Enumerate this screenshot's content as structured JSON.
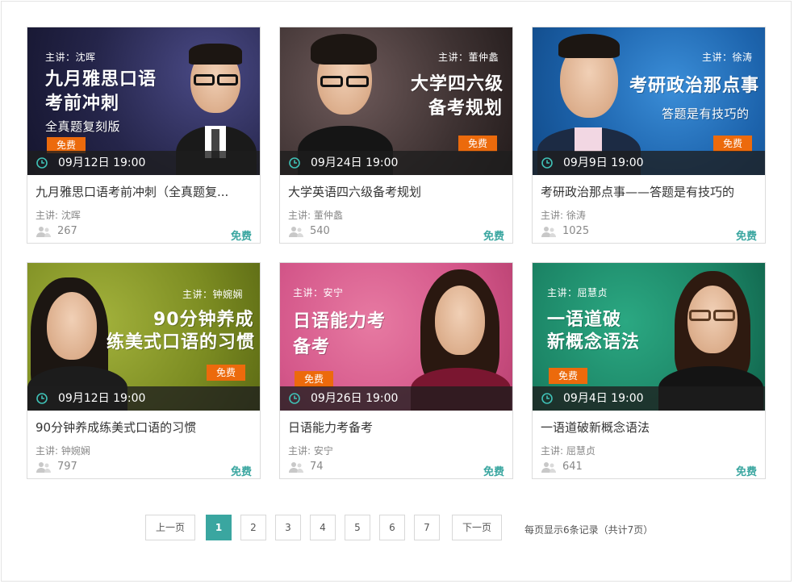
{
  "courses": [
    {
      "banner_teacher": "主讲：沈晖",
      "banner_lines": [
        "九月雅思口语",
        "考前冲刺"
      ],
      "banner_sub": "全真题复刻版",
      "free_badge": "免费",
      "datetime": "09月12日 19:00",
      "title": "九月雅思口语考前冲刺（全真题复...",
      "teacher": "主讲: 沈晖",
      "views": "267",
      "price": "免费",
      "bg_color": "#2a2a52"
    },
    {
      "banner_teacher": "主讲：董仲蠡",
      "banner_lines": [
        "大学四六级",
        "备考规划"
      ],
      "banner_sub": "",
      "free_badge": "免费",
      "datetime": "09月24日 19:00",
      "title": "大学英语四六级备考规划",
      "teacher": "主讲: 董仲蠡",
      "views": "540",
      "price": "免费",
      "bg_color": "#5a4a4a"
    },
    {
      "banner_teacher": "主讲：徐涛",
      "banner_lines": [
        "考研政治那点事"
      ],
      "banner_sub": "答题是有技巧的",
      "free_badge": "免费",
      "datetime": "09月9日 19:00",
      "title": "考研政治那点事——答题是有技巧的",
      "teacher": "主讲: 徐涛",
      "views": "1025",
      "price": "免费",
      "bg_color": "#1f6fb8"
    },
    {
      "banner_teacher": "主讲：钟婉娴",
      "banner_lines": [
        "90分钟养成",
        "练美式口语的习惯"
      ],
      "banner_sub": "",
      "free_badge": "免费",
      "datetime": "09月12日 19:00",
      "title": "90分钟养成练美式口语的习惯",
      "teacher": "主讲: 钟婉娴",
      "views": "797",
      "price": "免费",
      "bg_color": "#8a9a2a"
    },
    {
      "banner_teacher": "主讲：安宁",
      "banner_lines": [
        "日语能力考",
        "备考"
      ],
      "banner_sub": "",
      "free_badge": "免费",
      "datetime": "09月26日 19:00",
      "title": "日语能力考备考",
      "teacher": "主讲: 安宁",
      "views": "74",
      "price": "免费",
      "bg_color": "#d85c8a"
    },
    {
      "banner_teacher": "主讲：屈慧贞",
      "banner_lines": [
        "一语道破",
        "新概念语法"
      ],
      "banner_sub": "",
      "free_badge": "免费",
      "datetime": "09月4日 19:00",
      "title": "一语道破新概念语法",
      "teacher": "主讲: 屈慧贞",
      "views": "641",
      "price": "免费",
      "bg_color": "#1f8a6a"
    }
  ],
  "pagination": {
    "prev": "上一页",
    "pages": [
      "1",
      "2",
      "3",
      "4",
      "5",
      "6",
      "7"
    ],
    "current": "1",
    "next": "下一页",
    "info": "每页显示6条记录（共计7页）"
  },
  "colors": {
    "accent": "#3aa6a0",
    "free_badge": "#ec6a0c"
  },
  "icons": {
    "clock": "clock-icon",
    "viewers": "people-icon"
  }
}
